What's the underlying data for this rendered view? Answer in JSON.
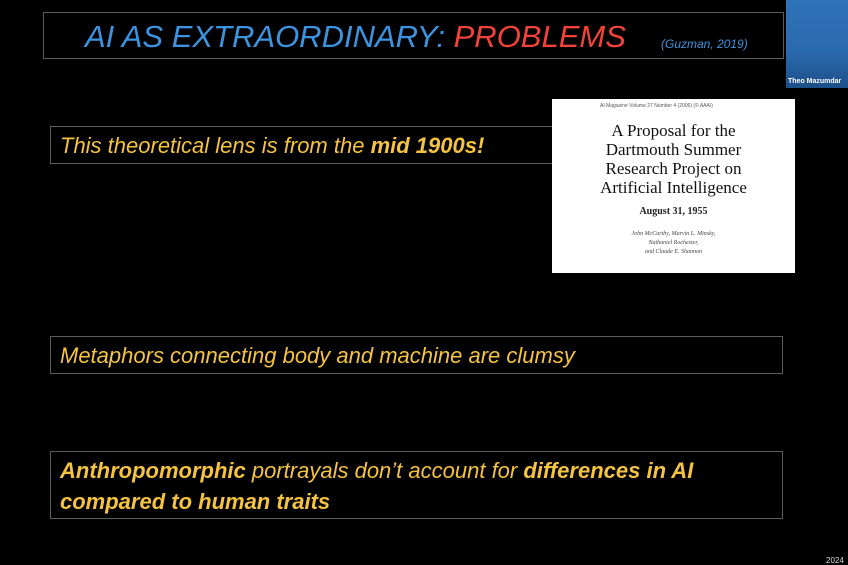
{
  "slide": {
    "title_part1": "AI AS EXTRAORDINARY: ",
    "title_part2": "PROBLEMS",
    "citation": "(Guzman, 2019)",
    "bullet1": {
      "text": "This theoretical lens is from the ",
      "bold": "mid 1900s!"
    },
    "bullet2": {
      "text": "Metaphors connecting body and machine are clumsy"
    },
    "bullet3": {
      "bold1": "Anthropomorphic",
      "text1": " portrayals don’t account for ",
      "bold2": "differences in AI compared to human traits"
    },
    "paper": {
      "header": "AI Magazine Volume 27 Number 4 (2006) (© AAAI)",
      "title_line1": "A Proposal for the",
      "title_line2": "Dartmouth Summer",
      "title_line3": "Research Project on",
      "title_line4": "Artificial Intelligence",
      "date": "August 31, 1955",
      "authors_line1": "John McCarthy, Marvin L. Minsky,",
      "authors_line2": "Nathaniel Rochester,",
      "authors_line3": "and Claude E. Shannon"
    }
  },
  "webcam": {
    "participant_name": "Theo Mazumdar"
  },
  "footer": {
    "year_fragment": "2024"
  },
  "colors": {
    "title_blue": "#3c93df",
    "title_red": "#f2423a",
    "bullet_yellow": "#f6c341"
  }
}
